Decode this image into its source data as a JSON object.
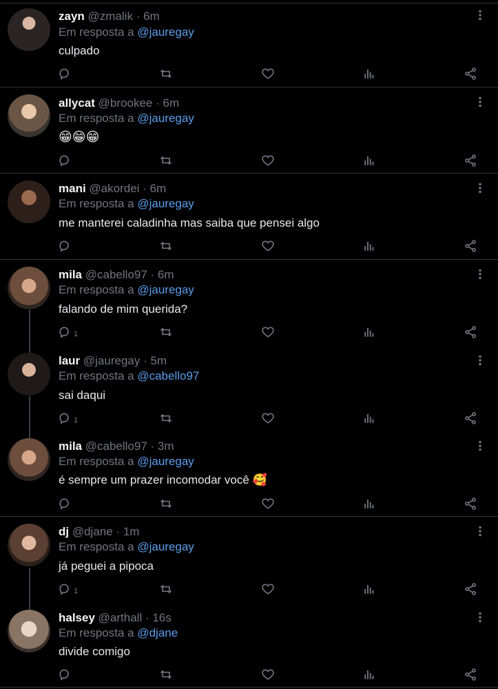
{
  "colors": {
    "background": "#000000",
    "text": "#e7e9ea",
    "muted": "#71767b",
    "mention": "#5b9ded",
    "divider": "#2f3336",
    "thread": "#3a3f44"
  },
  "reply_prefix": "Em resposta a",
  "tweets": [
    {
      "name": "zayn",
      "handle": "@zmalik",
      "time": "· 6m",
      "reply_to": "@jauregay",
      "text": "culpado",
      "reply_count": ""
    },
    {
      "name": "allycat",
      "handle": "@brookee",
      "time": "· 6m",
      "reply_to": "@jauregay",
      "text": "",
      "emoji": "😁😁😁",
      "reply_count": ""
    },
    {
      "name": "mani",
      "handle": "@akordei",
      "time": "· 6m",
      "reply_to": "@jauregay",
      "text": "me manterei caladinha mas saiba que pensei algo",
      "reply_count": ""
    },
    {
      "name": "mila",
      "handle": "@cabello97",
      "time": "· 6m",
      "reply_to": "@jauregay",
      "text": "falando de mim querida?",
      "reply_count": "1"
    },
    {
      "name": "laur",
      "handle": "@jauregay",
      "time": "· 5m",
      "reply_to": "@cabello97",
      "text": "sai daqui",
      "reply_count": "1"
    },
    {
      "name": "mila",
      "handle": "@cabello97",
      "time": "· 3m",
      "reply_to": "@jauregay",
      "text": "é sempre um prazer incomodar você",
      "emoji": "🥰",
      "reply_count": ""
    },
    {
      "name": "dj",
      "handle": "@djane",
      "time": "· 1m",
      "reply_to": "@jauregay",
      "text": "já peguei a pipoca",
      "reply_count": "1"
    },
    {
      "name": "halsey",
      "handle": "@arthall",
      "time": "· 16s",
      "reply_to": "@djane",
      "text": "divide comigo",
      "reply_count": ""
    }
  ],
  "icons": {
    "reply": "speech-bubble-icon",
    "retweet": "retweet-icon",
    "like": "heart-icon",
    "views": "bar-chart-icon",
    "share": "share-icon",
    "more": "vertical-dots-icon"
  }
}
